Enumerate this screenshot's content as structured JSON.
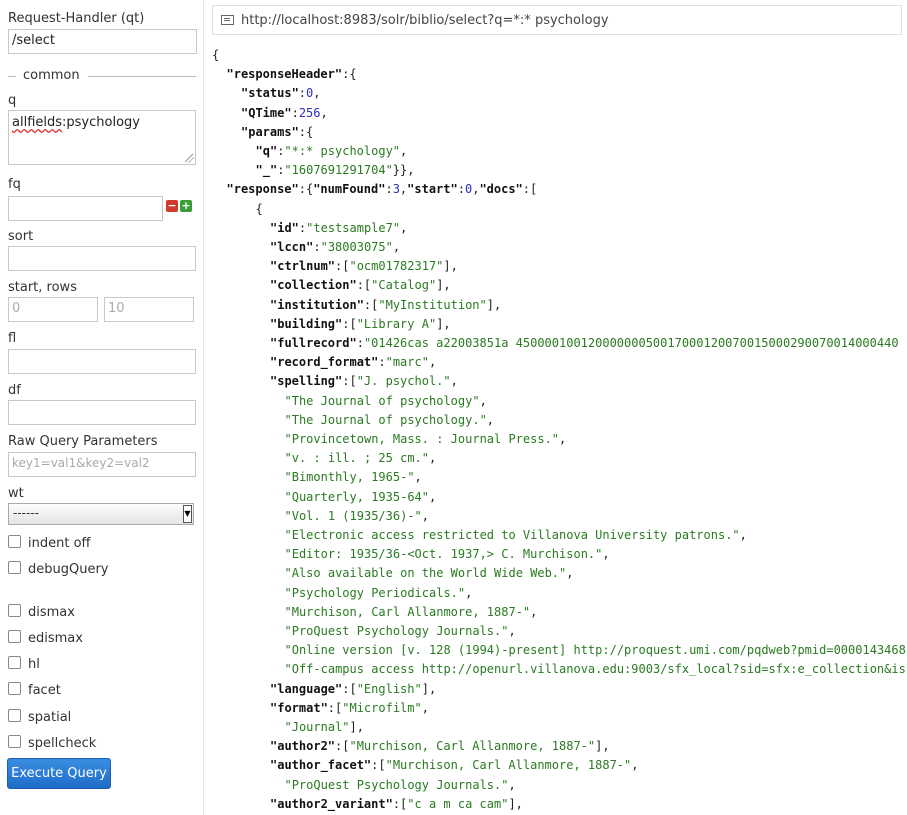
{
  "form": {
    "request_handler_label": "Request-Handler (qt)",
    "request_handler_value": "/select",
    "common_legend": "common",
    "q_label": "q",
    "q_value_prefix": "allfields",
    "q_value_rest": ":psychology",
    "fq_label": "fq",
    "fq_value": "",
    "fq_remove_icon": "minus-icon",
    "fq_add_icon": "plus-icon",
    "sort_label": "sort",
    "sort_value": "",
    "start_rows_label": "start, rows",
    "start_value": "0",
    "rows_value": "10",
    "fl_label": "fl",
    "fl_value": "",
    "df_label": "df",
    "df_value": "",
    "raw_label": "Raw Query Parameters",
    "raw_placeholder": "key1=val1&key2=val2",
    "wt_label": "wt",
    "wt_value": "------",
    "checkboxes": [
      "indent off",
      "debugQuery",
      "dismax",
      "edismax",
      "hl",
      "facet",
      "spatial",
      "spellcheck"
    ],
    "execute_label": "Execute Query",
    "execute_color": "#2a7bd6"
  },
  "url": "http://localhost:8983/solr/biblio/select?q=*:* psychology",
  "colors": {
    "json_string": "#2a7a22",
    "json_number": "#2d2dc4",
    "accent": "#2a7bd6"
  },
  "response_lines": [
    {
      "indent": 0,
      "parts": [
        [
          "p",
          "{"
        ]
      ]
    },
    {
      "indent": 2,
      "parts": [
        [
          "k",
          "\"responseHeader\""
        ],
        [
          "p",
          ":{"
        ]
      ]
    },
    {
      "indent": 4,
      "parts": [
        [
          "k",
          "\"status\""
        ],
        [
          "p",
          ":"
        ],
        [
          "n",
          "0"
        ],
        [
          "p",
          ","
        ]
      ]
    },
    {
      "indent": 4,
      "parts": [
        [
          "k",
          "\"QTime\""
        ],
        [
          "p",
          ":"
        ],
        [
          "n",
          "256"
        ],
        [
          "p",
          ","
        ]
      ]
    },
    {
      "indent": 4,
      "parts": [
        [
          "k",
          "\"params\""
        ],
        [
          "p",
          ":{"
        ]
      ]
    },
    {
      "indent": 6,
      "parts": [
        [
          "k",
          "\"q\""
        ],
        [
          "p",
          ":"
        ],
        [
          "s",
          "\"*:* psychology\""
        ],
        [
          "p",
          ","
        ]
      ]
    },
    {
      "indent": 6,
      "parts": [
        [
          "k",
          "\"_\""
        ],
        [
          "p",
          ":"
        ],
        [
          "s",
          "\"1607691291704\""
        ],
        [
          "p",
          "}},"
        ]
      ]
    },
    {
      "indent": 2,
      "parts": [
        [
          "k",
          "\"response\""
        ],
        [
          "p",
          ":{"
        ],
        [
          "k",
          "\"numFound\""
        ],
        [
          "p",
          ":"
        ],
        [
          "n",
          "3"
        ],
        [
          "p",
          ","
        ],
        [
          "k",
          "\"start\""
        ],
        [
          "p",
          ":"
        ],
        [
          "n",
          "0"
        ],
        [
          "p",
          ","
        ],
        [
          "k",
          "\"docs\""
        ],
        [
          "p",
          ":["
        ]
      ]
    },
    {
      "indent": 6,
      "parts": [
        [
          "p",
          "{"
        ]
      ]
    },
    {
      "indent": 8,
      "parts": [
        [
          "k",
          "\"id\""
        ],
        [
          "p",
          ":"
        ],
        [
          "s",
          "\"testsample7\""
        ],
        [
          "p",
          ","
        ]
      ]
    },
    {
      "indent": 8,
      "parts": [
        [
          "k",
          "\"lccn\""
        ],
        [
          "p",
          ":"
        ],
        [
          "s",
          "\"38003075\""
        ],
        [
          "p",
          ","
        ]
      ]
    },
    {
      "indent": 8,
      "parts": [
        [
          "k",
          "\"ctrlnum\""
        ],
        [
          "p",
          ":["
        ],
        [
          "s",
          "\"ocm01782317\""
        ],
        [
          "p",
          "],"
        ]
      ]
    },
    {
      "indent": 8,
      "parts": [
        [
          "k",
          "\"collection\""
        ],
        [
          "p",
          ":["
        ],
        [
          "s",
          "\"Catalog\""
        ],
        [
          "p",
          "],"
        ]
      ]
    },
    {
      "indent": 8,
      "parts": [
        [
          "k",
          "\"institution\""
        ],
        [
          "p",
          ":["
        ],
        [
          "s",
          "\"MyInstitution\""
        ],
        [
          "p",
          "],"
        ]
      ]
    },
    {
      "indent": 8,
      "parts": [
        [
          "k",
          "\"building\""
        ],
        [
          "p",
          ":["
        ],
        [
          "s",
          "\"Library A\""
        ],
        [
          "p",
          "],"
        ]
      ]
    },
    {
      "indent": 8,
      "parts": [
        [
          "k",
          "\"fullrecord\""
        ],
        [
          "p",
          ":"
        ],
        [
          "s",
          "\"01426cas a22003851a 45000010012000000050017000120070015000290070014000440"
        ]
      ]
    },
    {
      "indent": 8,
      "parts": [
        [
          "k",
          "\"record_format\""
        ],
        [
          "p",
          ":"
        ],
        [
          "s",
          "\"marc\""
        ],
        [
          "p",
          ","
        ]
      ]
    },
    {
      "indent": 8,
      "parts": [
        [
          "k",
          "\"spelling\""
        ],
        [
          "p",
          ":["
        ],
        [
          "s",
          "\"J. psychol.\""
        ],
        [
          "p",
          ","
        ]
      ]
    },
    {
      "indent": 10,
      "parts": [
        [
          "s",
          "\"The Journal of psychology\""
        ],
        [
          "p",
          ","
        ]
      ]
    },
    {
      "indent": 10,
      "parts": [
        [
          "s",
          "\"The Journal of psychology.\""
        ],
        [
          "p",
          ","
        ]
      ]
    },
    {
      "indent": 10,
      "parts": [
        [
          "s",
          "\"Provincetown, Mass. : Journal Press.\""
        ],
        [
          "p",
          ","
        ]
      ]
    },
    {
      "indent": 10,
      "parts": [
        [
          "s",
          "\"v. : ill. ; 25 cm.\""
        ],
        [
          "p",
          ","
        ]
      ]
    },
    {
      "indent": 10,
      "parts": [
        [
          "s",
          "\"Bimonthly, 1965-\""
        ],
        [
          "p",
          ","
        ]
      ]
    },
    {
      "indent": 10,
      "parts": [
        [
          "s",
          "\"Quarterly, 1935-64\""
        ],
        [
          "p",
          ","
        ]
      ]
    },
    {
      "indent": 10,
      "parts": [
        [
          "s",
          "\"Vol. 1 (1935/36)-\""
        ],
        [
          "p",
          ","
        ]
      ]
    },
    {
      "indent": 10,
      "parts": [
        [
          "s",
          "\"Electronic access restricted to Villanova University patrons.\""
        ],
        [
          "p",
          ","
        ]
      ]
    },
    {
      "indent": 10,
      "parts": [
        [
          "s",
          "\"Editor: 1935/36-<Oct. 1937,> C. Murchison.\""
        ],
        [
          "p",
          ","
        ]
      ]
    },
    {
      "indent": 10,
      "parts": [
        [
          "s",
          "\"Also available on the World Wide Web.\""
        ],
        [
          "p",
          ","
        ]
      ]
    },
    {
      "indent": 10,
      "parts": [
        [
          "s",
          "\"Psychology Periodicals.\""
        ],
        [
          "p",
          ","
        ]
      ]
    },
    {
      "indent": 10,
      "parts": [
        [
          "s",
          "\"Murchison, Carl Allanmore, 1887-\""
        ],
        [
          "p",
          ","
        ]
      ]
    },
    {
      "indent": 10,
      "parts": [
        [
          "s",
          "\"ProQuest Psychology Journals.\""
        ],
        [
          "p",
          ","
        ]
      ]
    },
    {
      "indent": 10,
      "parts": [
        [
          "s",
          "\"Online version [v. 128 (1994)-present] http://proquest.umi.com/pqdweb?pmid=0000143468"
        ]
      ]
    },
    {
      "indent": 10,
      "parts": [
        [
          "s",
          "\"Off-campus access http://openurl.villanova.edu:9003/sfx_local?sid=sfx:e_collection&is"
        ]
      ]
    },
    {
      "indent": 8,
      "parts": [
        [
          "k",
          "\"language\""
        ],
        [
          "p",
          ":["
        ],
        [
          "s",
          "\"English\""
        ],
        [
          "p",
          "],"
        ]
      ]
    },
    {
      "indent": 8,
      "parts": [
        [
          "k",
          "\"format\""
        ],
        [
          "p",
          ":["
        ],
        [
          "s",
          "\"Microfilm\""
        ],
        [
          "p",
          ","
        ]
      ]
    },
    {
      "indent": 10,
      "parts": [
        [
          "s",
          "\"Journal\""
        ],
        [
          "p",
          "],"
        ]
      ]
    },
    {
      "indent": 8,
      "parts": [
        [
          "k",
          "\"author2\""
        ],
        [
          "p",
          ":["
        ],
        [
          "s",
          "\"Murchison, Carl Allanmore, 1887-\""
        ],
        [
          "p",
          "],"
        ]
      ]
    },
    {
      "indent": 8,
      "parts": [
        [
          "k",
          "\"author_facet\""
        ],
        [
          "p",
          ":["
        ],
        [
          "s",
          "\"Murchison, Carl Allanmore, 1887-\""
        ],
        [
          "p",
          ","
        ]
      ]
    },
    {
      "indent": 10,
      "parts": [
        [
          "s",
          "\"ProQuest Psychology Journals.\""
        ],
        [
          "p",
          ","
        ]
      ]
    },
    {
      "indent": 8,
      "parts": [
        [
          "k",
          "\"author2_variant\""
        ],
        [
          "p",
          ":["
        ],
        [
          "s",
          "\"c a m ca cam\""
        ],
        [
          "p",
          "],"
        ]
      ]
    }
  ]
}
